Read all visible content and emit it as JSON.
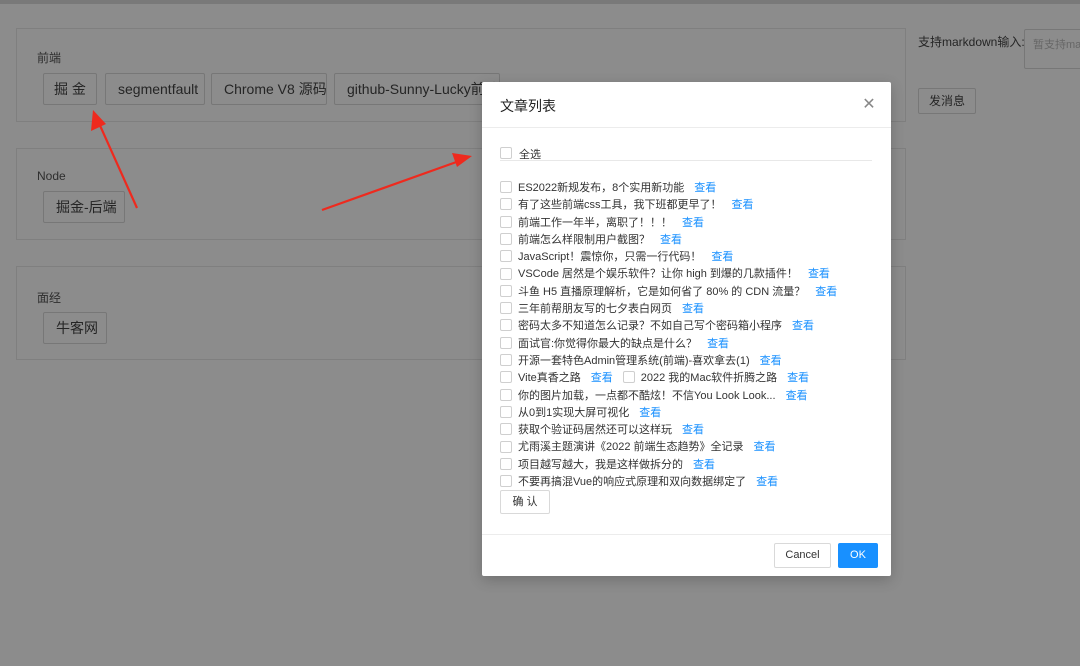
{
  "page": {
    "sections": [
      {
        "title": "前端",
        "buttons": [
          "掘 金",
          "segmentfault",
          "Chrome V8 源码",
          "github-Sunny-Lucky前端"
        ]
      },
      {
        "title": "Node",
        "buttons": [
          "掘金-后端"
        ]
      },
      {
        "title": "面经",
        "buttons": [
          "牛客网"
        ]
      }
    ],
    "side": {
      "label": "支持markdown输入:",
      "placeholder": "暂支持ma",
      "send_label": "发消息"
    }
  },
  "modal": {
    "title": "文章列表",
    "select_all": "全选",
    "view_label": "查看",
    "articles": [
      "ES2022新规发布，8个实用新功能",
      "有了这些前端css工具，我下班都更早了！",
      "前端工作一年半，离职了！！！",
      "前端怎么样限制用户截图？",
      "JavaScript！震惊你，只需一行代码！",
      "VSCode 居然是个娱乐软件？让你 high 到爆的几款插件！",
      "斗鱼 H5 直播原理解析，它是如何省了 80% 的 CDN 流量？",
      "三年前帮朋友写的七夕表白网页",
      "密码太多不知道怎么记录？不如自己写个密码箱小程序",
      "面试官:你觉得你最大的缺点是什么？",
      "开源一套特色Admin管理系统(前端)-喜欢拿去(1)",
      "Vite真香之路",
      "你的图片加载，一点都不酷炫！不信You Look Look...",
      "从0到1实现大屏可视化",
      "获取个验证码居然还可以这样玩",
      "尤雨溪主题演讲《2022 前端生态趋势》全记录",
      "项目越写越大，我是这样做拆分的",
      "不要再搞混Vue的响应式原理和双向数据绑定了"
    ],
    "inline_article": "2022 我的Mac软件折腾之路",
    "confirm_label": "确 认",
    "cancel_label": "Cancel",
    "ok_label": "OK"
  },
  "colors": {
    "primary": "#1890ff",
    "arrow": "#ee2a1e",
    "mask": "rgba(0,0,0,0.45)"
  }
}
